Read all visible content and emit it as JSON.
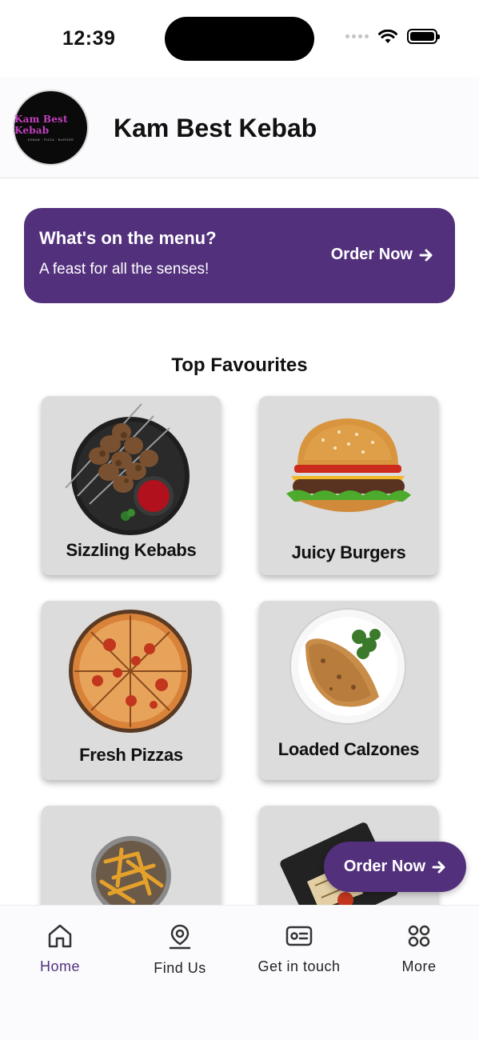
{
  "status": {
    "time": "12:39"
  },
  "header": {
    "logo_text": "Kam Best Kebab",
    "logo_subtext": "KEBAB · PIZZA · BURGER",
    "title": "Kam Best Kebab"
  },
  "banner": {
    "title": "What's on the menu?",
    "subtitle": "A feast for all the senses!",
    "cta": "Order Now"
  },
  "favourites": {
    "title": "Top Favourites",
    "items": [
      {
        "label": "Sizzling Kebabs",
        "icon": "kebab-image"
      },
      {
        "label": "Juicy Burgers",
        "icon": "burger-image"
      },
      {
        "label": "Fresh Pizzas",
        "icon": "pizza-image"
      },
      {
        "label": "Loaded Calzones",
        "icon": "calzone-image"
      },
      {
        "label": "",
        "icon": "fries-image"
      },
      {
        "label": "",
        "icon": "wraps-image"
      }
    ]
  },
  "fab": {
    "label": "Order Now"
  },
  "tabs": [
    {
      "label": "Home",
      "icon": "home-icon",
      "active": true
    },
    {
      "label": "Find Us",
      "icon": "location-pin-icon",
      "active": false
    },
    {
      "label": "Get in touch",
      "icon": "contact-card-icon",
      "active": false
    },
    {
      "label": "More",
      "icon": "grid-icon",
      "active": false
    }
  ],
  "colors": {
    "primary": "#52307c",
    "card": "#dcdcdc",
    "background": "#ffffff"
  }
}
